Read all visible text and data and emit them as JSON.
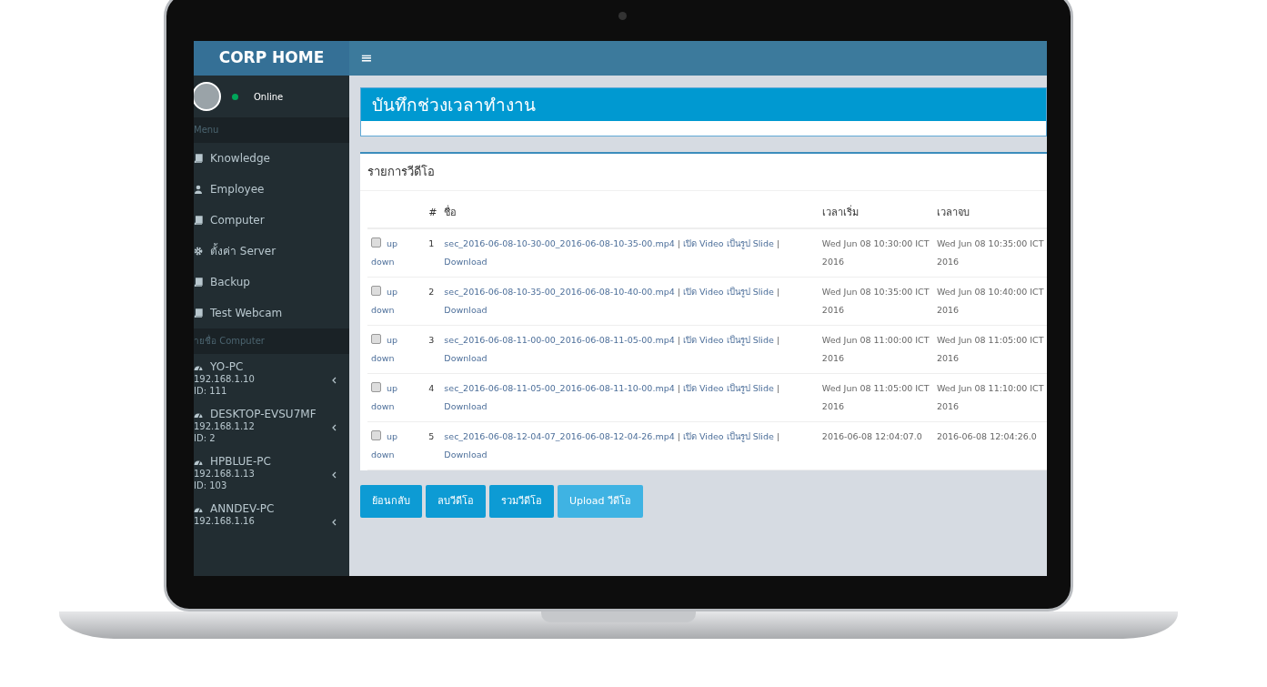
{
  "header": {
    "brand": "CORP HOME",
    "menu_toggle": "≡"
  },
  "user": {
    "status": "Online",
    "online": true
  },
  "sidebar": {
    "menu_heading": "Menu",
    "items": [
      {
        "label": "Knowledge",
        "kind": "book"
      },
      {
        "label": "Employee",
        "kind": "user"
      },
      {
        "label": "Computer",
        "kind": "book"
      },
      {
        "label": "ตั้งค่า Server",
        "kind": "gear"
      },
      {
        "label": "Backup",
        "kind": "book"
      },
      {
        "label": "Test Webcam",
        "kind": "book"
      }
    ],
    "computers_heading": "ายชื่อ Computer",
    "computers": [
      {
        "name": "YO-PC",
        "ip": "192.168.1.10",
        "id": "ID: 111"
      },
      {
        "name": "DESKTOP-EVSU7MF",
        "ip": "192.168.1.12",
        "id": "ID: 2"
      },
      {
        "name": "HPBLUE-PC",
        "ip": "192.168.1.13",
        "id": "ID: 103"
      },
      {
        "name": "ANNDEV-PC",
        "ip": "192.168.1.16"
      }
    ]
  },
  "page_title": "บันทึกช่วงเวลาทำงาน",
  "panel": {
    "title": "รายการวีดีโอ",
    "columns": [
      "#",
      "ชื่อ",
      "เวลาเริ่ม",
      "เวลาจบ"
    ],
    "rows": [
      {
        "checked": false,
        "up": "up",
        "down": "down",
        "number": "1",
        "file": "sec_2016-06-08-10-30-00_2016-06-08-10-35-00.mp4",
        "separator": "|",
        "open_video": "เปิด Video",
        "slides": "เป็นรูป Slide",
        "download": "Download",
        "start": "Wed Jun 08 10:30:00 ICT 2016",
        "end": "Wed Jun 08 10:35:00 ICT 2016"
      },
      {
        "checked": false,
        "up": "up",
        "down": "down",
        "number": "2",
        "file": "sec_2016-06-08-10-35-00_2016-06-08-10-40-00.mp4",
        "separator": "|",
        "open_video": "เปิด Video",
        "slides": "เป็นรูป Slide",
        "download": "Download",
        "start": "Wed Jun 08 10:35:00 ICT 2016",
        "end": "Wed Jun 08 10:40:00 ICT 2016"
      },
      {
        "checked": false,
        "up": "up",
        "down": "down",
        "number": "3",
        "file": "sec_2016-06-08-11-00-00_2016-06-08-11-05-00.mp4",
        "separator": "|",
        "open_video": "เปิด Video",
        "slides": "เป็นรูป Slide",
        "download": "Download",
        "start": "Wed Jun 08 11:00:00 ICT 2016",
        "end": "Wed Jun 08 11:05:00 ICT 2016"
      },
      {
        "checked": false,
        "up": "up",
        "down": "down",
        "number": "4",
        "file": "sec_2016-06-08-11-05-00_2016-06-08-11-10-00.mp4",
        "separator": "|",
        "open_video": "เปิด Video",
        "slides": "เป็นรูป Slide",
        "download": "Download",
        "start": "Wed Jun 08 11:05:00 ICT 2016",
        "end": "Wed Jun 08 11:10:00 ICT 2016"
      },
      {
        "checked": false,
        "up": "up",
        "down": "down",
        "number": "5",
        "file": "sec_2016-06-08-12-04-07_2016-06-08-12-04-26.mp4",
        "separator": "|",
        "open_video": "เปิด Video",
        "slides": "เป็นรูป Slide",
        "download": "Download",
        "start": "2016-06-08 12:04:07.0",
        "end": "2016-06-08 12:04:26.0"
      }
    ]
  },
  "buttons": [
    {
      "label": "ย้อนกลับ",
      "kind": "primary"
    },
    {
      "label": "ลบวีดีโอ",
      "kind": "primary"
    },
    {
      "label": "รวมวีดีโอ",
      "kind": "primary"
    },
    {
      "label": "Upload วีดีโอ",
      "kind": "light"
    }
  ]
}
